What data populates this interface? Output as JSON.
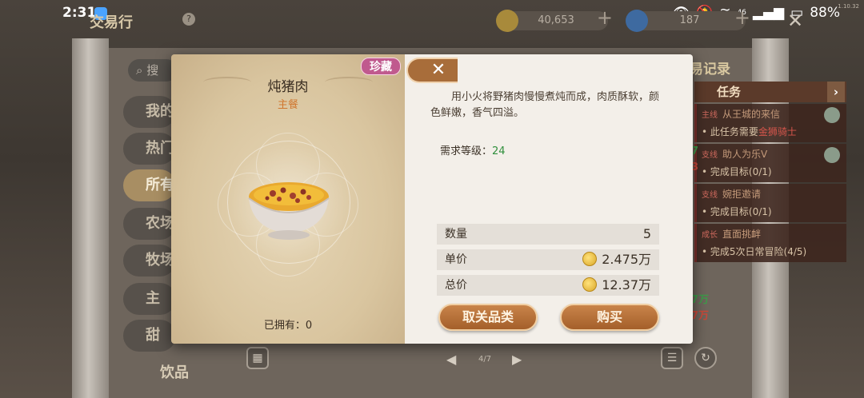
{
  "status_bar": {
    "time": "2:31",
    "battery": "88%",
    "signal": "46",
    "version": "1.10.32"
  },
  "game": {
    "title": "交易行",
    "help": "?"
  },
  "currency": {
    "coins": "40,653",
    "gems": "187",
    "plus": "+"
  },
  "search": {
    "placeholder": "搜"
  },
  "categories": [
    "我的",
    "热门",
    "所有",
    "农场",
    "牧场",
    "主",
    "甜",
    "饮品"
  ],
  "right_panel": {
    "title": "易记录",
    "tasks_header": "任务",
    "tasks": [
      {
        "tag": "主线",
        "title": "从王城的来信",
        "desc_pre": "此任务需要",
        "desc_hl": "金狮骑士"
      },
      {
        "tag": "支线",
        "title": "助人为乐V",
        "desc_pre": "完成目标(0/1)",
        "desc_hl": ""
      },
      {
        "tag": "支线",
        "title": "婉拒邀请",
        "desc_pre": "完成目标(0/1)",
        "desc_hl": ""
      },
      {
        "tag": "成长",
        "title": "直面挑衅",
        "desc_pre": "完成5次日常冒险(4/5)",
        "desc_hl": ""
      }
    ],
    "side_values": [
      "7",
      "3",
      "7万",
      "7万"
    ]
  },
  "pagination": {
    "page": "4/7"
  },
  "item": {
    "badge": "珍藏",
    "name": "炖猪肉",
    "type": "主餐",
    "owned_label": "已拥有：0",
    "description": "用小火将野猪肉慢慢煮炖而成，肉质酥软，颜色鲜嫩，香气四溢。",
    "required_level_label": "需求等级：",
    "required_level": "24",
    "quantity_label": "数量",
    "quantity": "5",
    "unit_price_label": "单价",
    "unit_price": "2.475万",
    "total_price_label": "总价",
    "total_price": "12.37万",
    "cancel_label": "取关品类",
    "buy_label": "购买"
  },
  "colors": {
    "accent": "#a45f2a",
    "badge": "#c05a8e",
    "level": "#2f8f3c",
    "type": "#d0762e"
  }
}
